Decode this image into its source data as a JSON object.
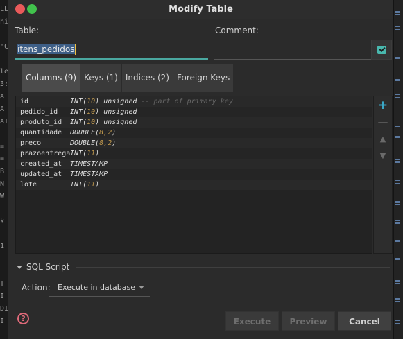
{
  "window": {
    "title": "Modify Table"
  },
  "background": {
    "left_fragments": [
      "LL",
      "hi",
      "'C",
      "le",
      "3:",
      "A",
      "A",
      "AI",
      "=",
      "=",
      "B",
      "N",
      "W",
      "k",
      "1",
      "T",
      "I",
      "DI",
      "I"
    ]
  },
  "form": {
    "table_label": "Table:",
    "table_value": "itens_pedidos",
    "comment_label": "Comment:",
    "comment_value": ""
  },
  "tabs": [
    {
      "label": "Columns (9)",
      "active": true
    },
    {
      "label": "Keys (1)",
      "active": false
    },
    {
      "label": "Indices (2)",
      "active": false
    },
    {
      "label": "Foreign Keys",
      "active": false
    }
  ],
  "columns": [
    {
      "name": "id",
      "type": "INT",
      "args": "10",
      "extra": "unsigned",
      "comment": "-- part of primary key"
    },
    {
      "name": "pedido_id",
      "type": "INT",
      "args": "10",
      "extra": "unsigned",
      "comment": ""
    },
    {
      "name": "produto_id",
      "type": "INT",
      "args": "10",
      "extra": "unsigned",
      "comment": ""
    },
    {
      "name": "quantidade",
      "type": "DOUBLE",
      "args": "8,2",
      "extra": "",
      "comment": ""
    },
    {
      "name": "preco",
      "type": "DOUBLE",
      "args": "8,2",
      "extra": "",
      "comment": ""
    },
    {
      "name": "prazoentrega",
      "type": "INT",
      "args": "11",
      "extra": "",
      "comment": ""
    },
    {
      "name": "created_at",
      "type": "TIMESTAMP",
      "args": "",
      "extra": "",
      "comment": ""
    },
    {
      "name": "updated_at",
      "type": "TIMESTAMP",
      "args": "",
      "extra": "",
      "comment": ""
    },
    {
      "name": "lote",
      "type": "INT",
      "args": "11",
      "extra": "",
      "comment": ""
    }
  ],
  "tools": {
    "add": "+",
    "remove": "—",
    "up": "▲",
    "down": "▼"
  },
  "sql": {
    "section_label": "SQL Script",
    "action_label": "Action:",
    "action_value": "Execute in database"
  },
  "buttons": {
    "help": "?",
    "execute": "Execute",
    "preview": "Preview",
    "cancel": "Cancel"
  },
  "colors": {
    "accent": "#4aa8a0",
    "selection": "#3e5f87",
    "number": "#c29a4e",
    "help": "#e06a7a"
  }
}
